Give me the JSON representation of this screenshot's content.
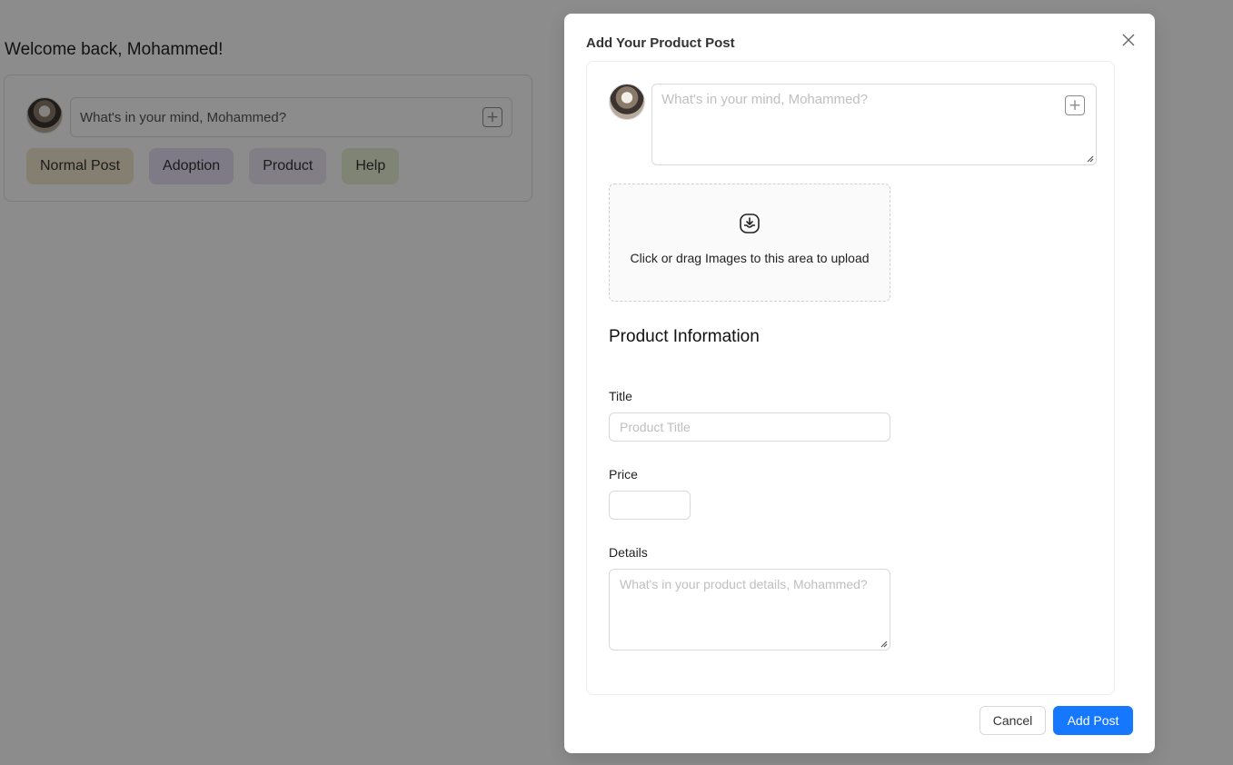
{
  "background": {
    "welcome": "Welcome back, Mohammed!",
    "composer_placeholder": "What's in your mind, Mohammed?",
    "chips": {
      "normal": "Normal Post",
      "adoption": "Adoption",
      "product": "Product",
      "help": "Help"
    }
  },
  "modal": {
    "title": "Add Your Product Post",
    "post_placeholder": "What's in your mind, Mohammed?",
    "upload_text": "Click or drag Images to this area to upload",
    "section_title": "Product Information",
    "title_label": "Title",
    "title_placeholder": "Product Title",
    "price_label": "Price",
    "price_value": "",
    "details_label": "Details",
    "details_placeholder": "What's in your product details, Mohammed?",
    "cancel_label": "Cancel",
    "add_label": "Add Post"
  },
  "colors": {
    "primary": "#1677ff",
    "overlay": "rgba(0,0,0,0.45)"
  },
  "icons": [
    "close-icon",
    "plus-square-icon",
    "inbox-icon",
    "avatar"
  ]
}
